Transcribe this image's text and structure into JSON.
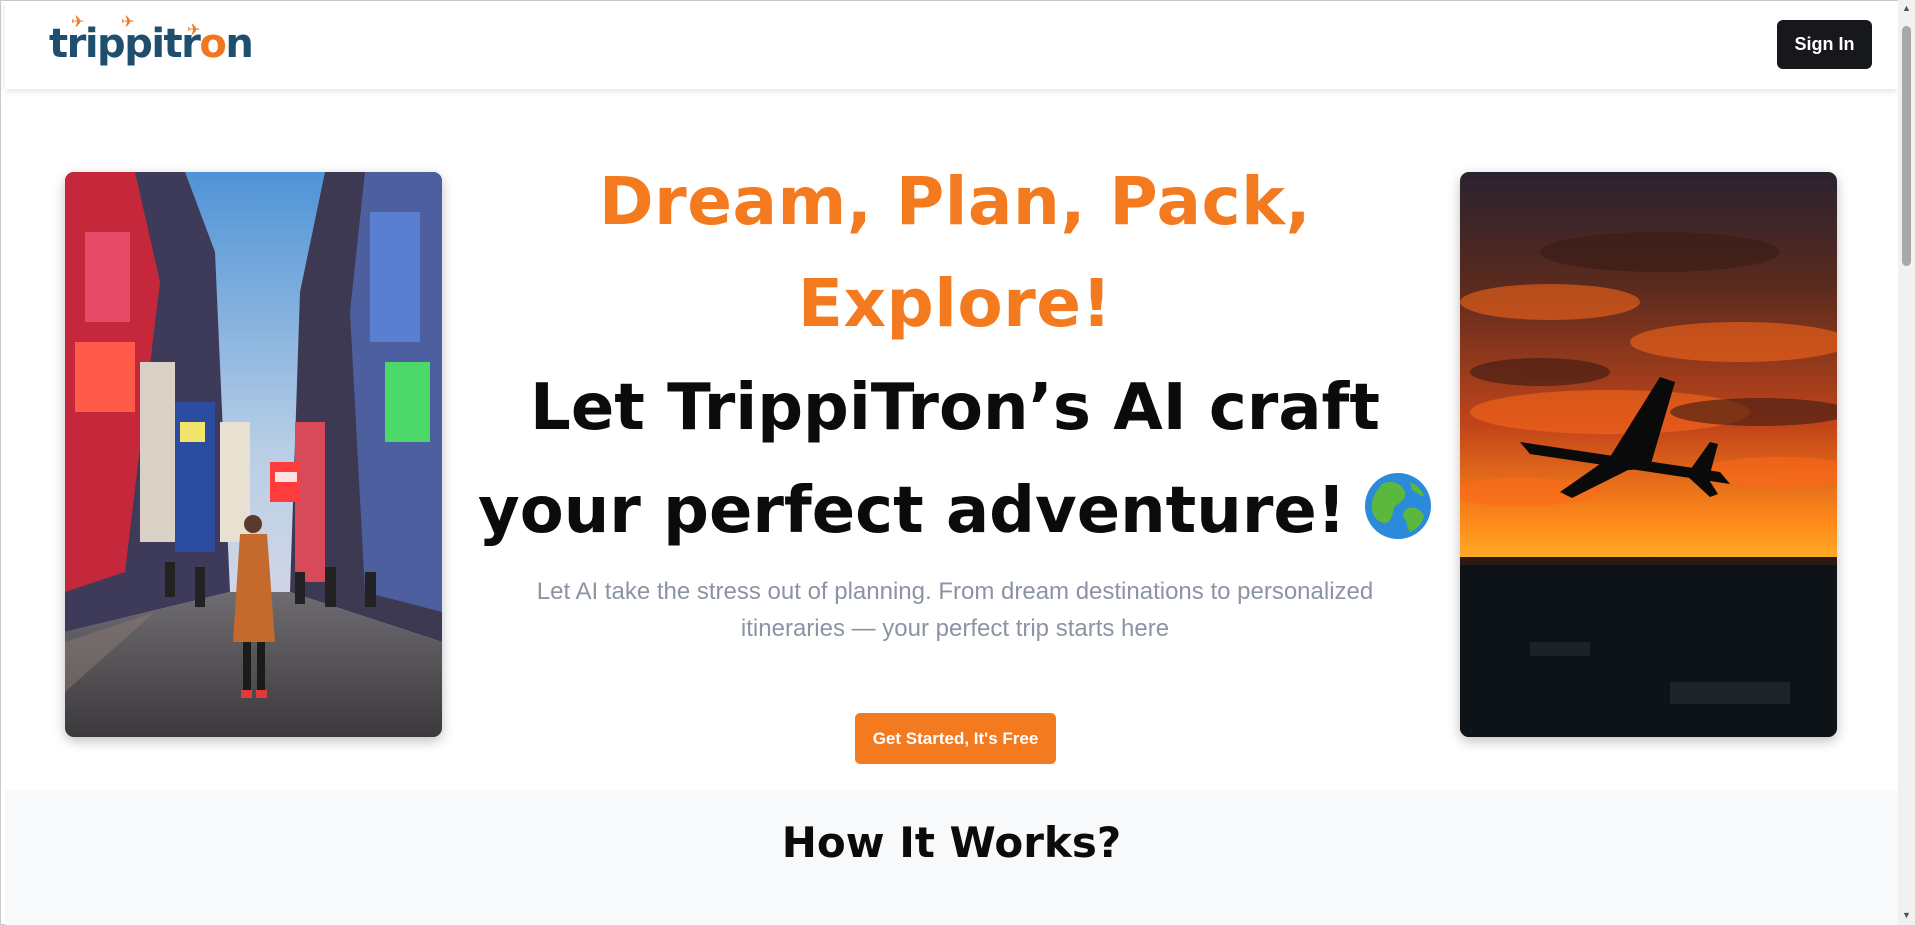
{
  "header": {
    "logo_text_a": "trippitr",
    "logo_text_o": "o",
    "logo_text_b": "n",
    "logo_icon": "airplane-icon",
    "sign_in_label": "Sign In"
  },
  "hero": {
    "headline_line1": "Dream, Plan, Pack,",
    "headline_line2": "Explore!",
    "tagline_line1": "Let TrippiTron’s AI craft",
    "tagline_line2": "your perfect adventure!",
    "tagline_icon": "globe-icon",
    "subtext": "Let AI take the stress out of planning. From dream destinations to personalized itineraries — your perfect trip starts here",
    "cta_label": "Get Started, It's Free",
    "left_image": "city-street-photo",
    "right_image": "airplane-sunset-photo"
  },
  "how_it_works": {
    "title": "How It Works?"
  },
  "colors": {
    "accent": "#f47a20",
    "brand_dark": "#1f4f6f",
    "button_dark": "#17181c",
    "muted_text": "#8c94a3"
  }
}
